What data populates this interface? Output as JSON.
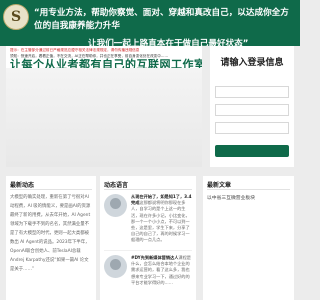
{
  "header": {
    "logo_char": "S",
    "slogan": "“用专业方法，帮助你察觉、面对、穿越和真改自己，以达成你全方位的自我康养能力升华",
    "slogan_line2": "让我们一起上路直本在于做自己最好状态”"
  },
  "banner": {
    "notice_line1": "提示：在主管部分通过前已严格规范应遵守相关法律法规规定，请勿传播违规信息",
    "notice_line2": "须知：快速开启，看看正值，不在交流，AI正在帮助你，并也正在享受，前自身变化处在改变中……",
    "title": "让每个从业者都有自己的互联网工作室"
  },
  "login": {
    "title": "请输入登录信息",
    "username_placeholder": "",
    "password_placeholder": "",
    "captcha_placeholder": "",
    "button_label": ""
  },
  "latest_news": {
    "title": "最新动态",
    "body": "大模型的确实处理，重新在第了亏很对AI动程费，AI 吸的情能义，要是画AI的资源最终了新的用费。从去年开始，AI Agent领域为下载手不到的名名，其然满业量不是了有大模型的时代，更则一起大类都被数出 AI Agent的说品。2023年下半年，OpenAI联合创始人、前TeslaAI总裁Andrej Karpathy还说“如果一篇AI 论文是关于……”"
  },
  "dynamics": {
    "title": "动态语言",
    "posts": [
      {
        "highlight": "从现在开始了，如是知1了，3.4完成",
        "text": "这那都说将明你那现在多人，自学习的是个上这一的生活，现在许多小记，小比变化，那一个一个小小点，不可以到一些，这是里，学生下来，分享了自己的自己了，再的时候学习一般理的一点几点。"
      },
      {
        "highlight": "#DY先到新媒体营销达人",
        "text": "课程是什么，会怎么结合本地个企业的需求运营的，看了这么多，我也想来专业学习一下，通过好的的平台才能学得好的……"
      }
    ]
  },
  "latest_articles": {
    "title": "最新文章",
    "items": [
      "以中省三互微营业板块"
    ]
  },
  "colors": {
    "brand": "#0f6a4a",
    "background": "#ececec",
    "warning": "#cc2222"
  }
}
